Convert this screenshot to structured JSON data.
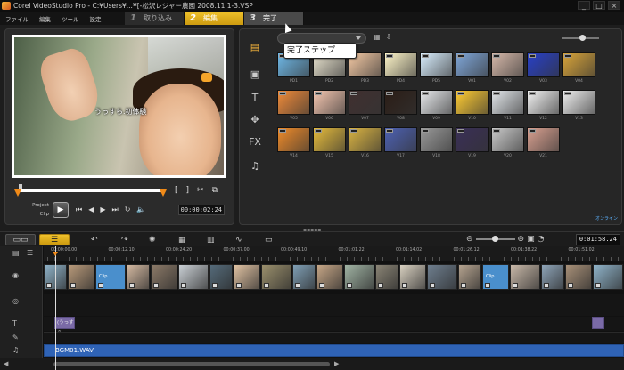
{
  "titlebar": {
    "title": "Corel VideoStudio Pro - C:¥Users¥...¥[-松沢レジャー農園 2008.11.1-3.VSP",
    "minimize": "_",
    "maximize": "□",
    "close": "×"
  },
  "menu": [
    "ファイル",
    "編集",
    "ツール",
    "設定"
  ],
  "steps": [
    {
      "num": "1",
      "label": "取り込み"
    },
    {
      "num": "2",
      "label": "編集"
    },
    {
      "num": "3",
      "label": "完了"
    }
  ],
  "tooltip": "完了ステップ",
  "preview": {
    "caption": "うっすら.初体験",
    "mode_labels": [
      "Project",
      "Clip"
    ],
    "timecode": "00:00:02:24"
  },
  "library": {
    "thumbs": [
      {
        "label": "PD1",
        "color": "#6fb9e8"
      },
      {
        "label": "PD2",
        "color": "#e9e3cf"
      },
      {
        "label": "PD3",
        "color": "#f3c8a3"
      },
      {
        "label": "PD4",
        "color": "#fff6c9"
      },
      {
        "label": "PD5",
        "color": "#d9efff"
      },
      {
        "label": "V01",
        "color": "#7fa6d8"
      },
      {
        "label": "V02",
        "color": "#d6b8a9"
      },
      {
        "label": "V03",
        "color": "#2840c8"
      },
      {
        "label": "V04",
        "color": "#d8a43a"
      },
      {
        "label": "V05",
        "color": "#f08b3a"
      },
      {
        "label": "V06",
        "color": "#f5c6b0"
      },
      {
        "label": "V07",
        "color": "#403030"
      },
      {
        "label": "V08",
        "color": "#2b1d16"
      },
      {
        "label": "V09",
        "color": "#e7e9ec"
      },
      {
        "label": "V10",
        "color": "#ffcc33"
      },
      {
        "label": "V11",
        "color": "#e2e6ea"
      },
      {
        "label": "V12",
        "color": "#f2f2f2"
      },
      {
        "label": "V13",
        "color": "#eeeeee"
      },
      {
        "label": "V14",
        "color": "#ef8b2a"
      },
      {
        "label": "V15",
        "color": "#e5bb3c"
      },
      {
        "label": "V16",
        "color": "#d8b242"
      },
      {
        "label": "V17",
        "color": "#4d61b2"
      },
      {
        "label": "V18",
        "color": "#999999"
      },
      {
        "label": "V19",
        "color": "#3a2f57"
      },
      {
        "label": "V20",
        "color": "#c9c9c9"
      },
      {
        "label": "V21",
        "color": "#d9a090"
      }
    ],
    "online_link": "オンライン"
  },
  "toolbar": {
    "time": "0:01:58.24"
  },
  "timeline": {
    "ticks": [
      "00:00:00.00",
      "00:00:12.10",
      "00:00:24.20",
      "00:00:37.00",
      "00:00:49.10",
      "00:01:01.22",
      "00:01:14.02",
      "00:01:26.12",
      "00:01:38.22",
      "00:01:51.02"
    ],
    "clip_label": "Clip",
    "title_clip": "(うっすら",
    "music": "BGM01.WAV"
  },
  "colors": {
    "accent": "#f0c22b",
    "music_track": "#2f63b6",
    "title_clip": "#7a6aa7"
  }
}
